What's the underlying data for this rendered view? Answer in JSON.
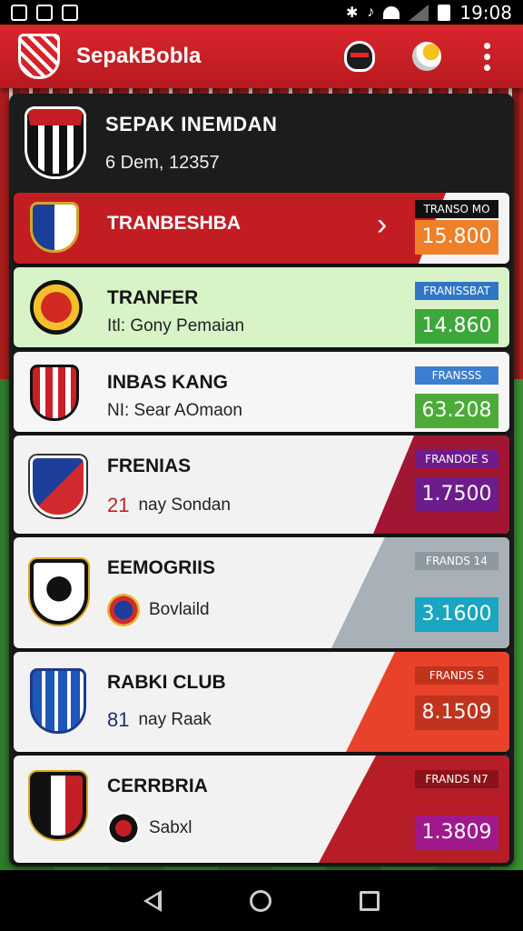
{
  "status_bar": {
    "time": "19:08"
  },
  "app_bar": {
    "title": "SepakBobla"
  },
  "header": {
    "title": "SEPAK INEMDAN",
    "subtitle": "6 Dem, 12357"
  },
  "rows": [
    {
      "name": "TRANBESHBA",
      "badge_label": "TRANSO MO",
      "badge_value": "15.800",
      "row_bg": "#c21d23",
      "badge_color": "#f07f2a",
      "label_bg": "#111111"
    },
    {
      "name": "TRANFER",
      "subtitle": "Itl: Gony Pemaian",
      "badge_label": "FRANISSBAT",
      "badge_value": "14.860",
      "row_bg": "#d7f3c7",
      "badge_color": "#3da83a",
      "label_bg": "#2f77c6"
    },
    {
      "name": "INBAS KANG",
      "subtitle": "NI: Sear AOmaon",
      "badge_label": "FRANSSS",
      "badge_value": "63.208",
      "row_bg": "#f6f6f6",
      "badge_color": "#4cab36",
      "label_bg": "#3a7fd0"
    },
    {
      "name": "FRENIAS",
      "sub_number": "21",
      "subtitle": "nay Sondan",
      "badge_label": "FRANDOE S",
      "badge_value": "1.7500",
      "row_bg": "#f2f2f2",
      "wedge": "#a11633",
      "badge_color": "#6e1c8c",
      "label_bg": "#6e1c8c"
    },
    {
      "name": "EEMOGRIIS",
      "subtitle": "Bovlaild",
      "badge_label": "FRANDS 14",
      "badge_value": "3.1600",
      "row_bg": "#f2f2f2",
      "wedge": "#a7b1b7",
      "badge_color": "#1aa5c0",
      "label_bg": "#8d98a0"
    },
    {
      "name": "RABKI CLUB",
      "sub_number": "81",
      "subtitle": "nay Raak",
      "badge_label": "FRANDS S",
      "badge_value": "8.1509",
      "row_bg": "#f2f2f2",
      "wedge": "#e8432a",
      "badge_color": "#c0331d",
      "label_bg": "#c0331d"
    },
    {
      "name": "CERRBRIA",
      "subtitle": "Sabxl",
      "badge_label": "FRANDS N7",
      "badge_value": "1.3809",
      "row_bg": "#f2f2f2",
      "wedge": "#b61d26",
      "badge_color": "#a0198c",
      "label_bg": "#8a1319"
    }
  ]
}
